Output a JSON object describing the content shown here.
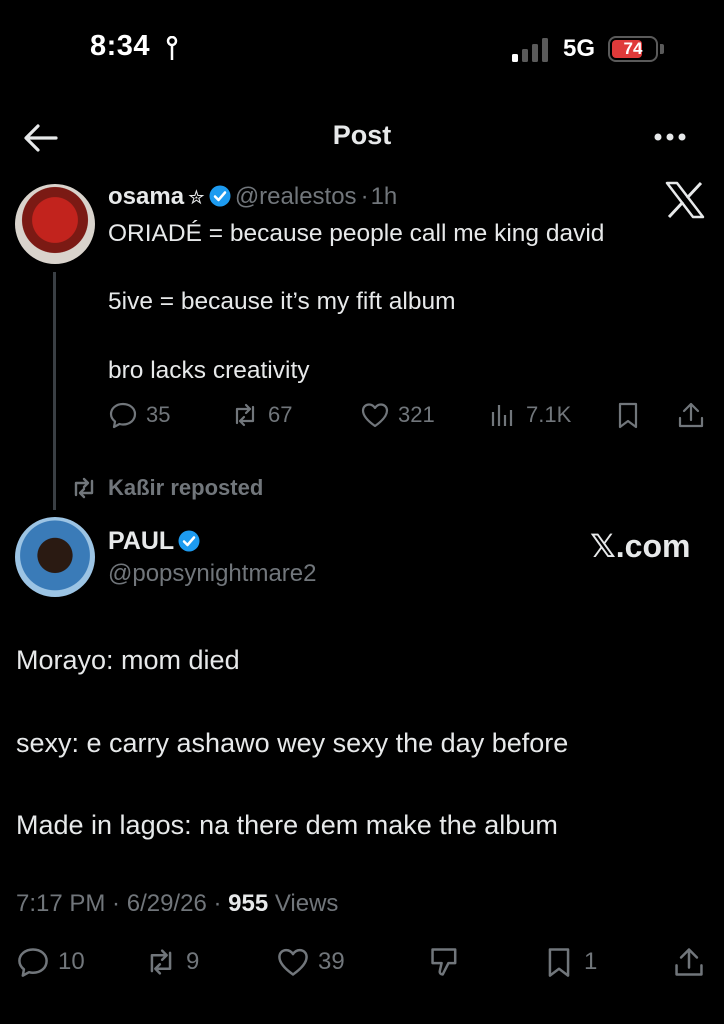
{
  "status_bar": {
    "time": "8:34",
    "network": "5G",
    "battery": "74"
  },
  "header": {
    "title": "Post"
  },
  "quoted_post": {
    "name": "osama",
    "star": "✮",
    "handle": "@realestos",
    "separator": "·",
    "age": "1h",
    "lines": [
      "ORIADÉ = because people call me king david",
      "5ive = because it’s my fift album",
      "bro lacks creativity"
    ],
    "replies": "35",
    "reposts": "67",
    "likes": "321",
    "views": "7.1K"
  },
  "repost_banner": {
    "text": "Kaßir reposted"
  },
  "post": {
    "name": "PAUL",
    "handle": "@popsynightmare2",
    "watermark": "𝕏.com",
    "lines": [
      "Morayo: mom died",
      "sexy: e carry ashawo wey sexy the day before",
      "Made in lagos: na there dem make the album"
    ],
    "time": "7:17 PM",
    "date": "6/29/26",
    "views_count": "955",
    "views_label": "Views",
    "replies": "10",
    "reposts": "9",
    "likes": "39",
    "bookmarks": "1"
  },
  "colors": {
    "background": "#000000",
    "text": "#e7e9ea",
    "muted": "#71767b",
    "verified": "#1d9bf0",
    "battery_low": "#e03a3a"
  }
}
